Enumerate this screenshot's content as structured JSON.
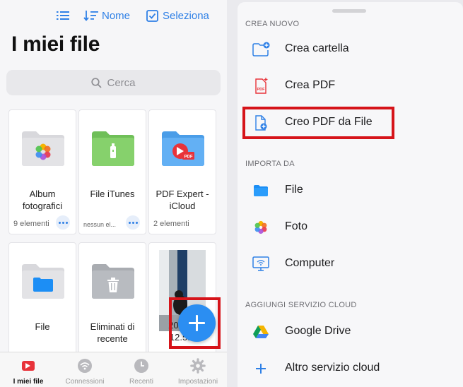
{
  "left": {
    "toolbar": {
      "sort_label": "Nome",
      "select_label": "Seleziona"
    },
    "title": "I miei file",
    "search_placeholder": "Cerca",
    "files": [
      {
        "name": "Album fotografici",
        "meta": "9 elementi"
      },
      {
        "name": "File iTunes",
        "meta": "nessun el..."
      },
      {
        "name": "PDF Expert - iCloud",
        "meta": "2 elementi"
      },
      {
        "name": "File",
        "meta": ""
      },
      {
        "name": "Eliminati di recente",
        "meta": ""
      },
      {
        "name": "2020...\n12.5...",
        "meta": ""
      }
    ],
    "tabs": [
      {
        "label": "I miei file",
        "icon": "pdf-expert-icon",
        "active": true
      },
      {
        "label": "Connessioni",
        "icon": "wifi-icon",
        "active": false
      },
      {
        "label": "Recenti",
        "icon": "clock-icon",
        "active": false
      },
      {
        "label": "Impostazioni",
        "icon": "gear-icon",
        "active": false
      }
    ]
  },
  "sheet": {
    "sections": {
      "create": "CREA NUOVO",
      "import": "IMPORTA DA",
      "cloud": "AGGIUNGI SERVIZIO CLOUD"
    },
    "create_items": [
      {
        "label": "Crea cartella",
        "icon": "new-folder-icon"
      },
      {
        "label": "Crea PDF",
        "icon": "new-pdf-icon"
      },
      {
        "label": "Creo PDF da File",
        "icon": "pdf-from-file-icon"
      }
    ],
    "import_items": [
      {
        "label": "File",
        "icon": "files-folder-icon"
      },
      {
        "label": "Foto",
        "icon": "photos-icon"
      },
      {
        "label": "Computer",
        "icon": "computer-wifi-icon"
      }
    ],
    "cloud_items": [
      {
        "label": "Google Drive",
        "icon": "google-drive-icon"
      },
      {
        "label": "Altro servizio cloud",
        "icon": "plus-icon"
      }
    ]
  },
  "colors": {
    "accent": "#2f80e6",
    "highlight": "#d6141a",
    "fab": "#2b8ef2"
  }
}
